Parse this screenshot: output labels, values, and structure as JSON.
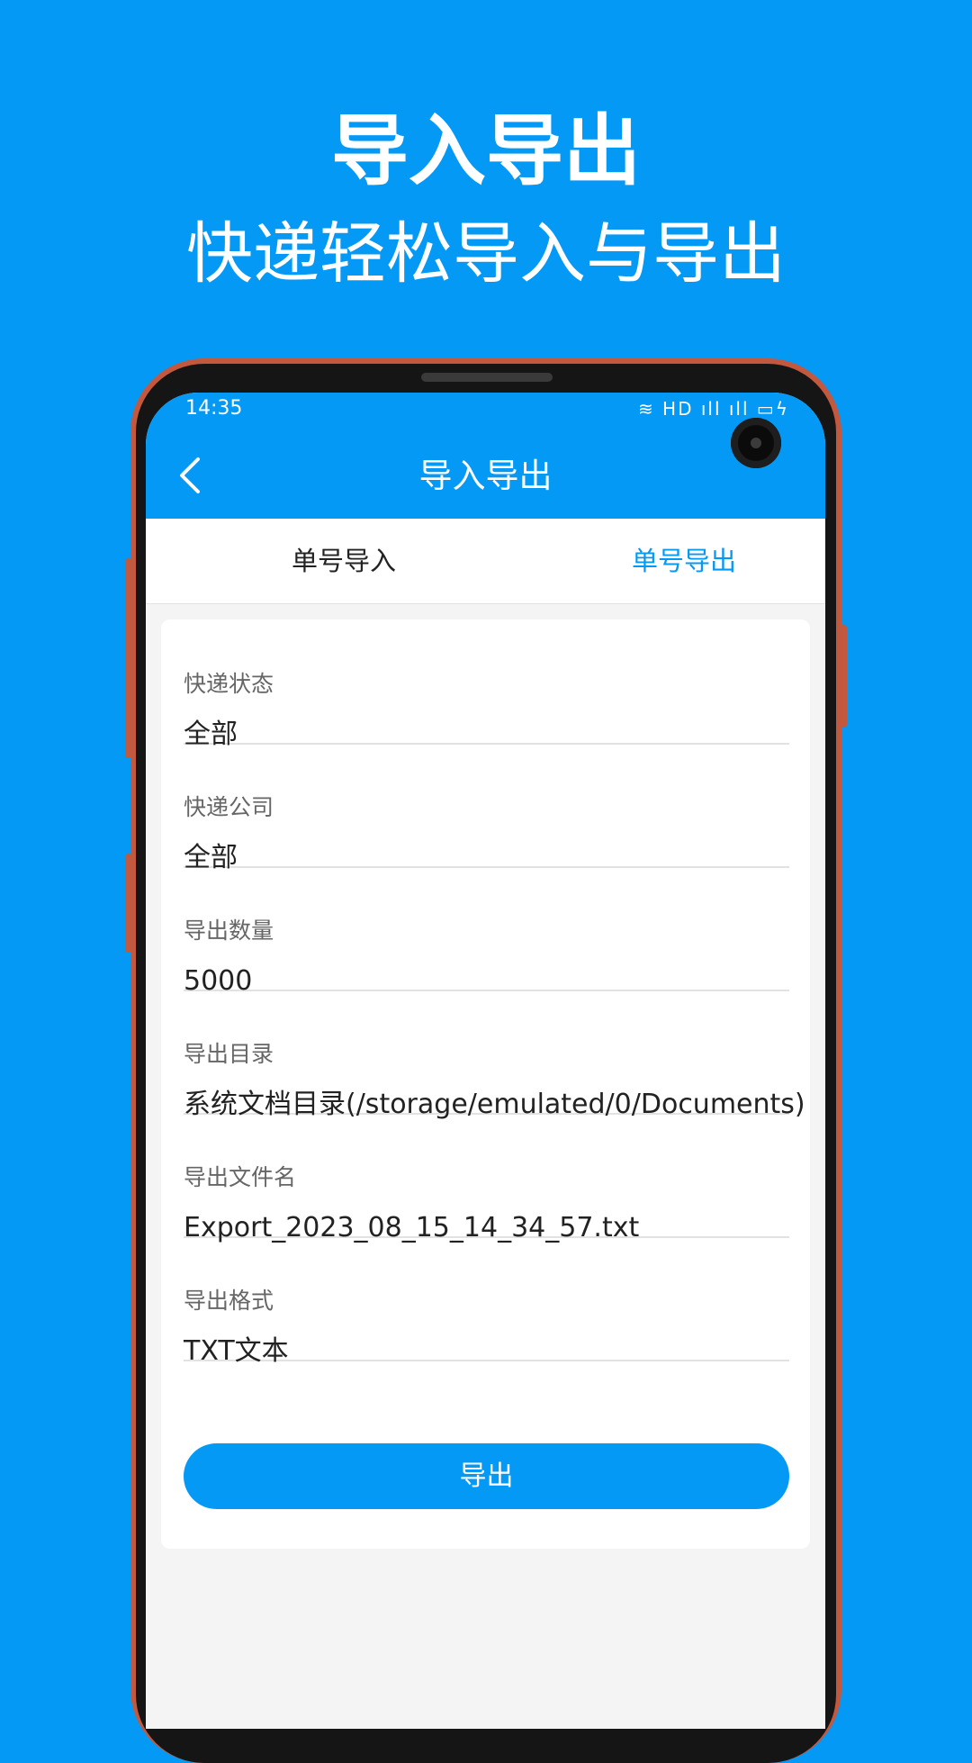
{
  "promo": {
    "title": "导入导出",
    "subtitle": "快递轻松导入与导出"
  },
  "status_bar": {
    "time": "14:35",
    "icons": [
      "wifi-icon",
      "hd-icon",
      "signal-icon",
      "signal-icon",
      "battery-icon"
    ],
    "icons_text": "≋ HD ıll ıll ▭ϟ"
  },
  "header": {
    "title": "导入导出",
    "back_icon": "chevron-left-icon"
  },
  "tabs": [
    {
      "label": "单号导入",
      "active": false
    },
    {
      "label": "单号导出",
      "active": true
    }
  ],
  "form": {
    "fields": [
      {
        "label": "快递状态",
        "value": "全部"
      },
      {
        "label": "快递公司",
        "value": "全部"
      },
      {
        "label": "导出数量",
        "value": "5000"
      },
      {
        "label": "导出目录",
        "value": "系统文档目录(/storage/emulated/0/Documents)"
      },
      {
        "label": "导出文件名",
        "value": "Export_2023_08_15_14_34_57.txt"
      },
      {
        "label": "导出格式",
        "value": "TXT文本"
      }
    ],
    "submit_label": "导出"
  },
  "colors": {
    "accent": "#0599f6",
    "background": "#f4f4f4",
    "phone_frame": "#c2583d"
  }
}
